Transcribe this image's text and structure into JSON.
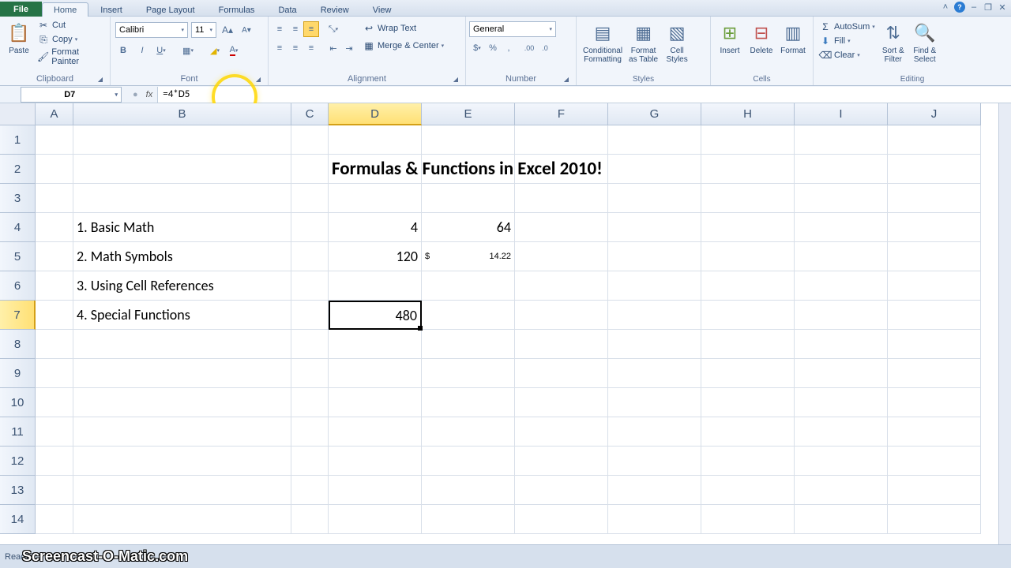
{
  "tabs": {
    "file": "File",
    "home": "Home",
    "insert": "Insert",
    "page_layout": "Page Layout",
    "formulas": "Formulas",
    "data": "Data",
    "review": "Review",
    "view": "View"
  },
  "ribbon": {
    "clipboard": {
      "label": "Clipboard",
      "paste": "Paste",
      "cut": "Cut",
      "copy": "Copy",
      "format_painter": "Format Painter"
    },
    "font": {
      "label": "Font",
      "name": "Calibri",
      "size": "11"
    },
    "alignment": {
      "label": "Alignment",
      "wrap": "Wrap Text",
      "merge": "Merge & Center"
    },
    "number": {
      "label": "Number",
      "format": "General"
    },
    "styles": {
      "label": "Styles",
      "conditional": "Conditional\nFormatting",
      "format_table": "Format\nas Table",
      "cell_styles": "Cell\nStyles"
    },
    "cells": {
      "label": "Cells",
      "insert": "Insert",
      "delete": "Delete",
      "format": "Format"
    },
    "editing": {
      "label": "Editing",
      "autosum": "AutoSum",
      "fill": "Fill",
      "clear": "Clear",
      "sort": "Sort &\nFilter",
      "find": "Find &\nSelect"
    }
  },
  "formula_bar": {
    "name_box": "D7",
    "formula": "=4*D5"
  },
  "columns": [
    "A",
    "B",
    "C",
    "D",
    "E",
    "F",
    "G",
    "H",
    "I",
    "J"
  ],
  "col_widths": {
    "A": 48,
    "B": 276,
    "C": 47,
    "D": 118,
    "E": 118,
    "F": 118,
    "G": 118,
    "H": 118,
    "I": 118,
    "J": 118
  },
  "selected_col": "D",
  "selected_row": 7,
  "cells": {
    "title": "Formulas & Functions in Excel 2010!",
    "b4": "1. Basic Math",
    "b5": "2. Math Symbols",
    "b6": "3. Using Cell References",
    "b7": "4. Special Functions",
    "d4": "4",
    "e4": "64",
    "d5": "120",
    "e5_sym": "$",
    "e5_val": "14.22",
    "d7": "480"
  },
  "status": {
    "ready": "Ready"
  },
  "watermark": "Screencast-O-Matic.com"
}
